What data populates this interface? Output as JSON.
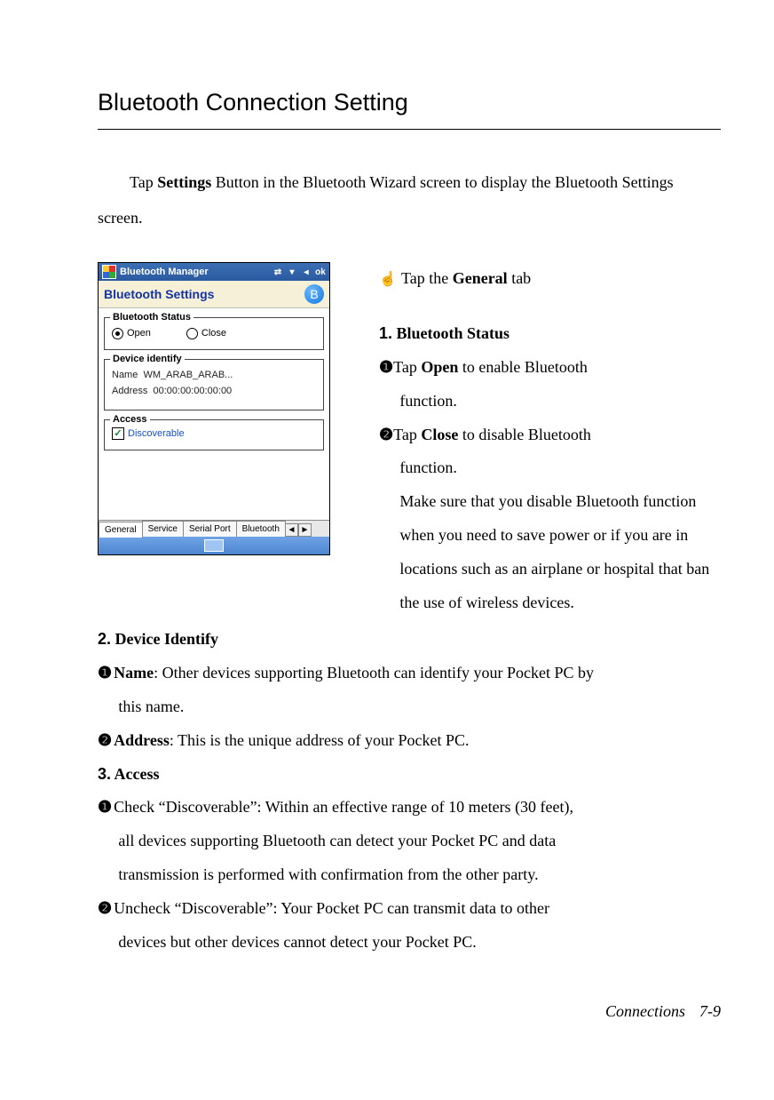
{
  "title": "Bluetooth Connection Setting",
  "intro_pre": "Tap ",
  "intro_bold": "Settings",
  "intro_post": " Button in the Bluetooth Wizard screen to display the Bluetooth Settings screen.",
  "screenshot": {
    "titlebar": "Bluetooth Manager",
    "ok": "ok",
    "subtitle": "Bluetooth Settings",
    "bt_glyph": "B",
    "status_legend": "Bluetooth Status",
    "radio_open": "Open",
    "radio_close": "Close",
    "device_legend": "Device identify",
    "name_label": "Name",
    "name_value": "WM_ARAB_ARAB...",
    "addr_label": "Address",
    "addr_value": "00:00:00:00:00:00",
    "access_legend": "Access",
    "discoverable": "Discoverable",
    "tabs": [
      "General",
      "Service",
      "Serial Port",
      "Bluetooth"
    ],
    "nav_left": "◄",
    "nav_right": "►"
  },
  "right": {
    "hand_icon": "☝",
    "hand_pre": " Tap the ",
    "hand_bold": "General",
    "hand_post": " tab",
    "sec1_num": "1.",
    "sec1_title": " Bluetooth Status",
    "s1i1_bullet": "❶",
    "s1i1_pre": "Tap ",
    "s1i1_bold": "Open",
    "s1i1_post": " to enable Bluetooth",
    "s1i1_line2": "function.",
    "s1i2_bullet": "❷",
    "s1i2_pre": "Tap ",
    "s1i2_bold": "Close",
    "s1i2_post": " to disable Bluetooth",
    "s1i2_line2": "function.",
    "s1_extra": "Make sure that you disable Bluetooth function when you need to save power or if you are in locations such as an airplane or hospital that ban the use of wireless devices."
  },
  "bottom": {
    "sec2_num": "2.",
    "sec2_title": " Device Identify",
    "s2i1_bullet": "❶",
    "s2i1_bold": "Name",
    "s2i1_text": ": Other devices supporting Bluetooth can identify your Pocket PC by",
    "s2i1_line2": "this name.",
    "s2i2_bullet": "❷",
    "s2i2_bold": "Address",
    "s2i2_text": ": This is the unique address of your Pocket PC.",
    "sec3_num": "3.",
    "sec3_title": " Access",
    "s3i1_bullet": "❶",
    "s3i1_text": "Check “Discoverable”: Within an effective range of 10 meters (30 feet),",
    "s3i1_line2": "all devices supporting Bluetooth can detect your Pocket PC and data",
    "s3i1_line3": "transmission is performed with confirmation from the other party.",
    "s3i2_bullet": "❷",
    "s3i2_text": "Uncheck “Discoverable”: Your Pocket PC can transmit data to other",
    "s3i2_line2": "devices but other devices cannot detect your Pocket PC."
  },
  "footer_section": "Connections",
  "footer_page": "7-9"
}
